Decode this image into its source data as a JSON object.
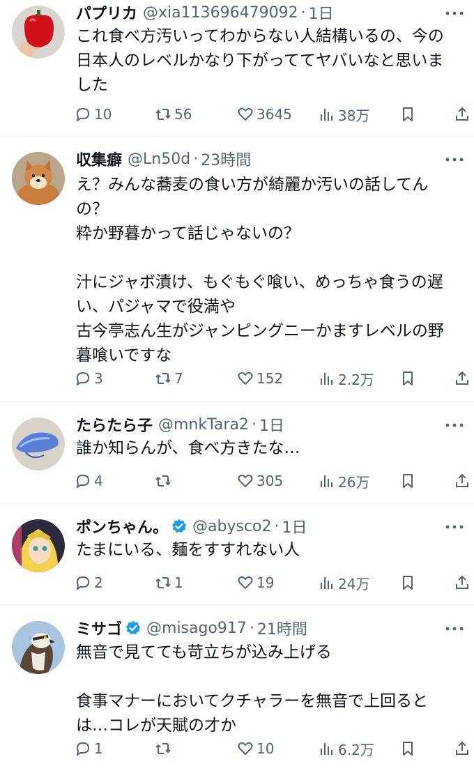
{
  "posts": [
    {
      "name": "パプリカ",
      "handle": "@xia113696479092",
      "separator": "·",
      "time": "1日",
      "lines": [
        "これ食べ方汚いってわからない人結構いるの、今の",
        "日本人のレベルかなり下がっててヤバいなと思いま",
        "した"
      ],
      "replies": "10",
      "retweets": "56",
      "likes": "3645",
      "views": "38万",
      "avatar": "red-bell-pepper-in-hand"
    },
    {
      "name": "収集癖",
      "handle": "@Ln50d",
      "separator": "·",
      "time": "23時間",
      "lines": [
        "え？みんな蕎麦の食い方が綺麗か汚いの話してん",
        "の？",
        "粋か野暮かって話じゃないの？",
        "",
        "汁にジャボ漬け、もぐもぐ喰い、めっちゃ食うの遅",
        "い、パジャマで役満や",
        "古今亭志ん生がジャンピングニーかますレベルの野",
        "暮喰いですな"
      ],
      "replies": "3",
      "retweets": "7",
      "likes": "152",
      "views": "2.2万",
      "avatar": "shiba-dog"
    },
    {
      "name": "たらたら子",
      "handle": "@mnkTara2",
      "separator": "·",
      "time": "1日",
      "lines": [
        "誰か知らんが、食べ方きたな…"
      ],
      "replies": "4",
      "retweets": "",
      "likes": "305",
      "views": "26万",
      "avatar": "blue-jellyfish"
    },
    {
      "name": "ポンちゃん。",
      "handle": "@abysco2",
      "separator": "·",
      "time": "1日",
      "verified": true,
      "lines": [
        "たまにいる、麺をすすれない人"
      ],
      "replies": "2",
      "retweets": "1",
      "likes": "19",
      "views": "24万",
      "avatar": "anime-character"
    },
    {
      "name": "ミサゴ",
      "handle": "@misago917",
      "separator": "·",
      "time": "21時間",
      "verified": true,
      "lines": [
        "無音で見てても苛立ちが込み上げる",
        "",
        "食事マナーにおいてクチャラーを無音で上回ると",
        "は…コレが天賦の才か"
      ],
      "replies": "1",
      "retweets": "",
      "likes": "10",
      "views": "6.2万",
      "avatar": "osprey-bird"
    }
  ],
  "colors": {
    "text": "#0f1419",
    "secondary": "#536471",
    "verified": "#1d9bf0",
    "divider": "#eff3f4"
  },
  "icons": [
    "reply-icon",
    "retweet-icon",
    "like-icon",
    "views-icon",
    "bookmark-icon",
    "share-icon",
    "more-icon",
    "verified-icon"
  ]
}
